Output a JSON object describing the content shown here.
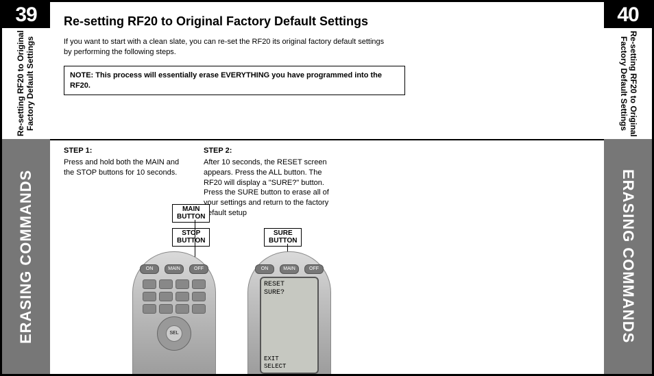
{
  "pages": {
    "left": {
      "number": "39",
      "subheading": "Re-setting RF20 to Original\nFactory Default Settings",
      "section": "ERASING COMMANDS"
    },
    "right": {
      "number": "40",
      "subheading": "Re-setting RF20 to Original\nFactory Default Settings",
      "section": "ERASING COMMANDS"
    }
  },
  "title": "Re-setting RF20 to Original Factory Default Settings",
  "intro": "If you want to start with a clean slate, you can re-set the RF20 its original factory default settings by performing the following steps.",
  "note": "NOTE: This process will essentially erase EVERYTHING you have programmed into the RF20.",
  "steps": [
    {
      "heading": "STEP 1:",
      "body": "Press and hold both the MAIN and the STOP buttons for 10 seconds."
    },
    {
      "heading": "STEP 2:",
      "body": "After 10 seconds, the RESET screen appears. Press the ALL button. The RF20 will display a \"SURE?\" button. Press the SURE button to erase all of your settings and return to the factory default setup"
    }
  ],
  "callouts": {
    "main_button": "MAIN\nBUTTON",
    "stop_button": "STOP\nBUTTON",
    "sure_button": "SURE\nBUTTON"
  },
  "remote": {
    "top_buttons": [
      "ON",
      "MAIN",
      "OFF"
    ],
    "dpad_center": "SEL",
    "screen": {
      "line1": "RESET",
      "line2": "SURE?",
      "exit": "EXIT",
      "select": "SELECT"
    }
  }
}
